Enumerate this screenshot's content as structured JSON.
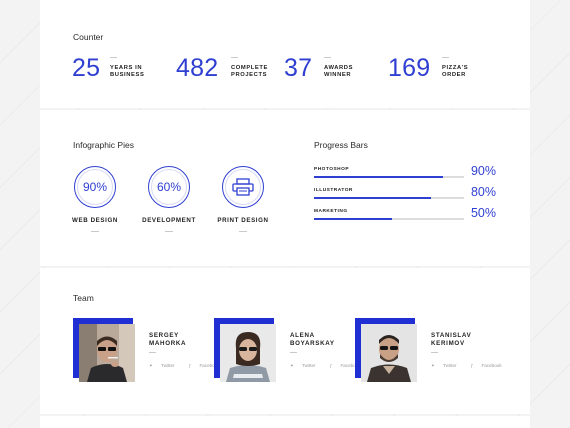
{
  "counter": {
    "title": "Counter",
    "items": [
      {
        "number": "25",
        "label_line1": "YEARS IN",
        "label_line2": "BUSINESS"
      },
      {
        "number": "482",
        "label_line1": "COMPLETE",
        "label_line2": "PROJECTS"
      },
      {
        "number": "37",
        "label_line1": "AWARDS",
        "label_line2": "WINNER"
      },
      {
        "number": "169",
        "label_line1": "PIZZA'S",
        "label_line2": "ORDER"
      }
    ]
  },
  "pies": {
    "title": "Infographic Pies",
    "items": [
      {
        "value": "90%",
        "label": "WEB DESIGN"
      },
      {
        "value": "60%",
        "label": "DEVELOPMENT"
      },
      {
        "icon": "printer-icon",
        "label": "PRINT DESIGN"
      }
    ]
  },
  "progress": {
    "title": "Progress Bars",
    "items": [
      {
        "label": "PHOTOSHOP",
        "value": "90%",
        "fraction": 0.86
      },
      {
        "label": "ILLUSTRATOR",
        "value": "80%",
        "fraction": 0.78
      },
      {
        "label": "MARKETING",
        "value": "50%",
        "fraction": 0.52
      }
    ]
  },
  "team": {
    "title": "Team",
    "members": [
      {
        "name_line1": "SERGEY",
        "name_line2": "MAHORKA",
        "twitter": "Twitter",
        "facebook": "Facebook"
      },
      {
        "name_line1": "ALENA",
        "name_line2": "BOYARSKAY",
        "twitter": "Twitter",
        "facebook": "Facebook"
      },
      {
        "name_line1": "STANISLAV",
        "name_line2": "KERIMOV",
        "twitter": "Twitter",
        "facebook": "Facebook"
      }
    ]
  },
  "colors": {
    "accent": "#2f3fd1",
    "photo_frame": "#1f2fd4"
  }
}
